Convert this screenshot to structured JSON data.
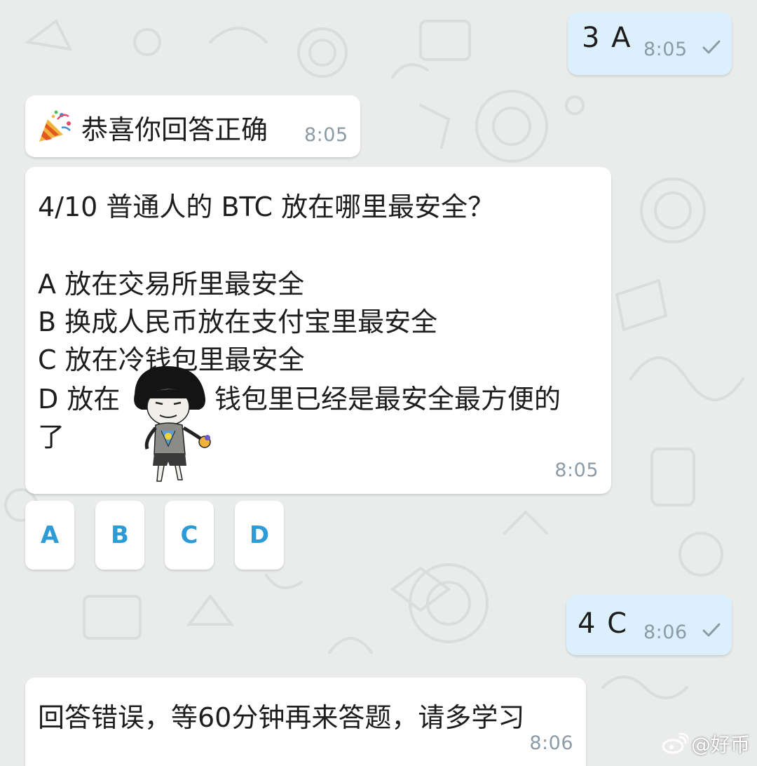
{
  "messages": {
    "out1": {
      "text": "3 A",
      "time": "8:05",
      "read_icon": "check-icon"
    },
    "congrats": {
      "icon": "party-popper-icon",
      "text": "恭喜你回答正确",
      "time": "8:05"
    },
    "question": {
      "title": "4/10 普通人的 BTC 放在哪里最安全？",
      "options": [
        "A 放在交易所里最安全",
        "B 换成人民币放在支付宝里最安全",
        "C 放在冷钱包里最安全",
        "D 放在",
        "钱包里已经是最安全最方便的",
        "了"
      ],
      "time": "8:05"
    },
    "out2": {
      "text": "4 C",
      "time": "8:06",
      "read_icon": "check-icon"
    },
    "wrong": {
      "text": "回答错误，等60分钟再来答题，请多学习",
      "time": "8:06"
    }
  },
  "answer_buttons": [
    "A",
    "B",
    "C",
    "D"
  ],
  "sticker": "meme-sticker-icon",
  "watermark": {
    "icon": "weibo-icon",
    "text": "@好币"
  },
  "colors": {
    "background": "#e9ecea",
    "outgoing_bubble": "#dbf0fc",
    "incoming_bubble": "#ffffff",
    "button_text": "#2f9bd6",
    "time_text": "#8c9ba6"
  }
}
